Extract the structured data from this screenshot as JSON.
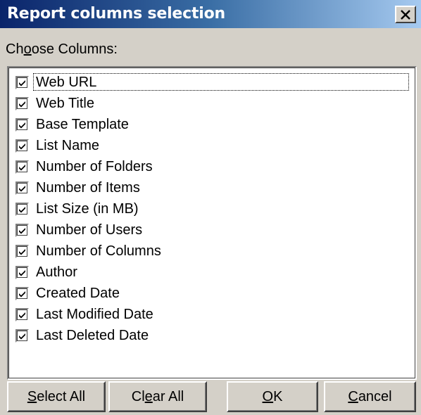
{
  "dialog": {
    "title": "Report columns selection",
    "close_icon": "close-icon"
  },
  "choose_label": {
    "pre": "Ch",
    "accel": "o",
    "post": "ose Columns:"
  },
  "columns": [
    {
      "label": "Web URL",
      "checked": true
    },
    {
      "label": "Web Title",
      "checked": true
    },
    {
      "label": "Base Template",
      "checked": true
    },
    {
      "label": "List Name",
      "checked": true
    },
    {
      "label": "Number of Folders",
      "checked": true
    },
    {
      "label": "Number of Items",
      "checked": true
    },
    {
      "label": "List Size (in MB)",
      "checked": true
    },
    {
      "label": "Number of Users",
      "checked": true
    },
    {
      "label": "Number of Columns",
      "checked": true
    },
    {
      "label": "Author",
      "checked": true
    },
    {
      "label": "Created Date",
      "checked": true
    },
    {
      "label": "Last Modified Date",
      "checked": true
    },
    {
      "label": "Last Deleted Date",
      "checked": true
    }
  ],
  "buttons": {
    "select_all": {
      "pre": "",
      "accel": "S",
      "post": "elect All"
    },
    "clear_all": {
      "pre": "Cl",
      "accel": "e",
      "post": "ar All"
    },
    "ok": {
      "pre": "",
      "accel": "O",
      "post": "K"
    },
    "cancel": {
      "pre": "",
      "accel": "C",
      "post": "ancel"
    }
  }
}
